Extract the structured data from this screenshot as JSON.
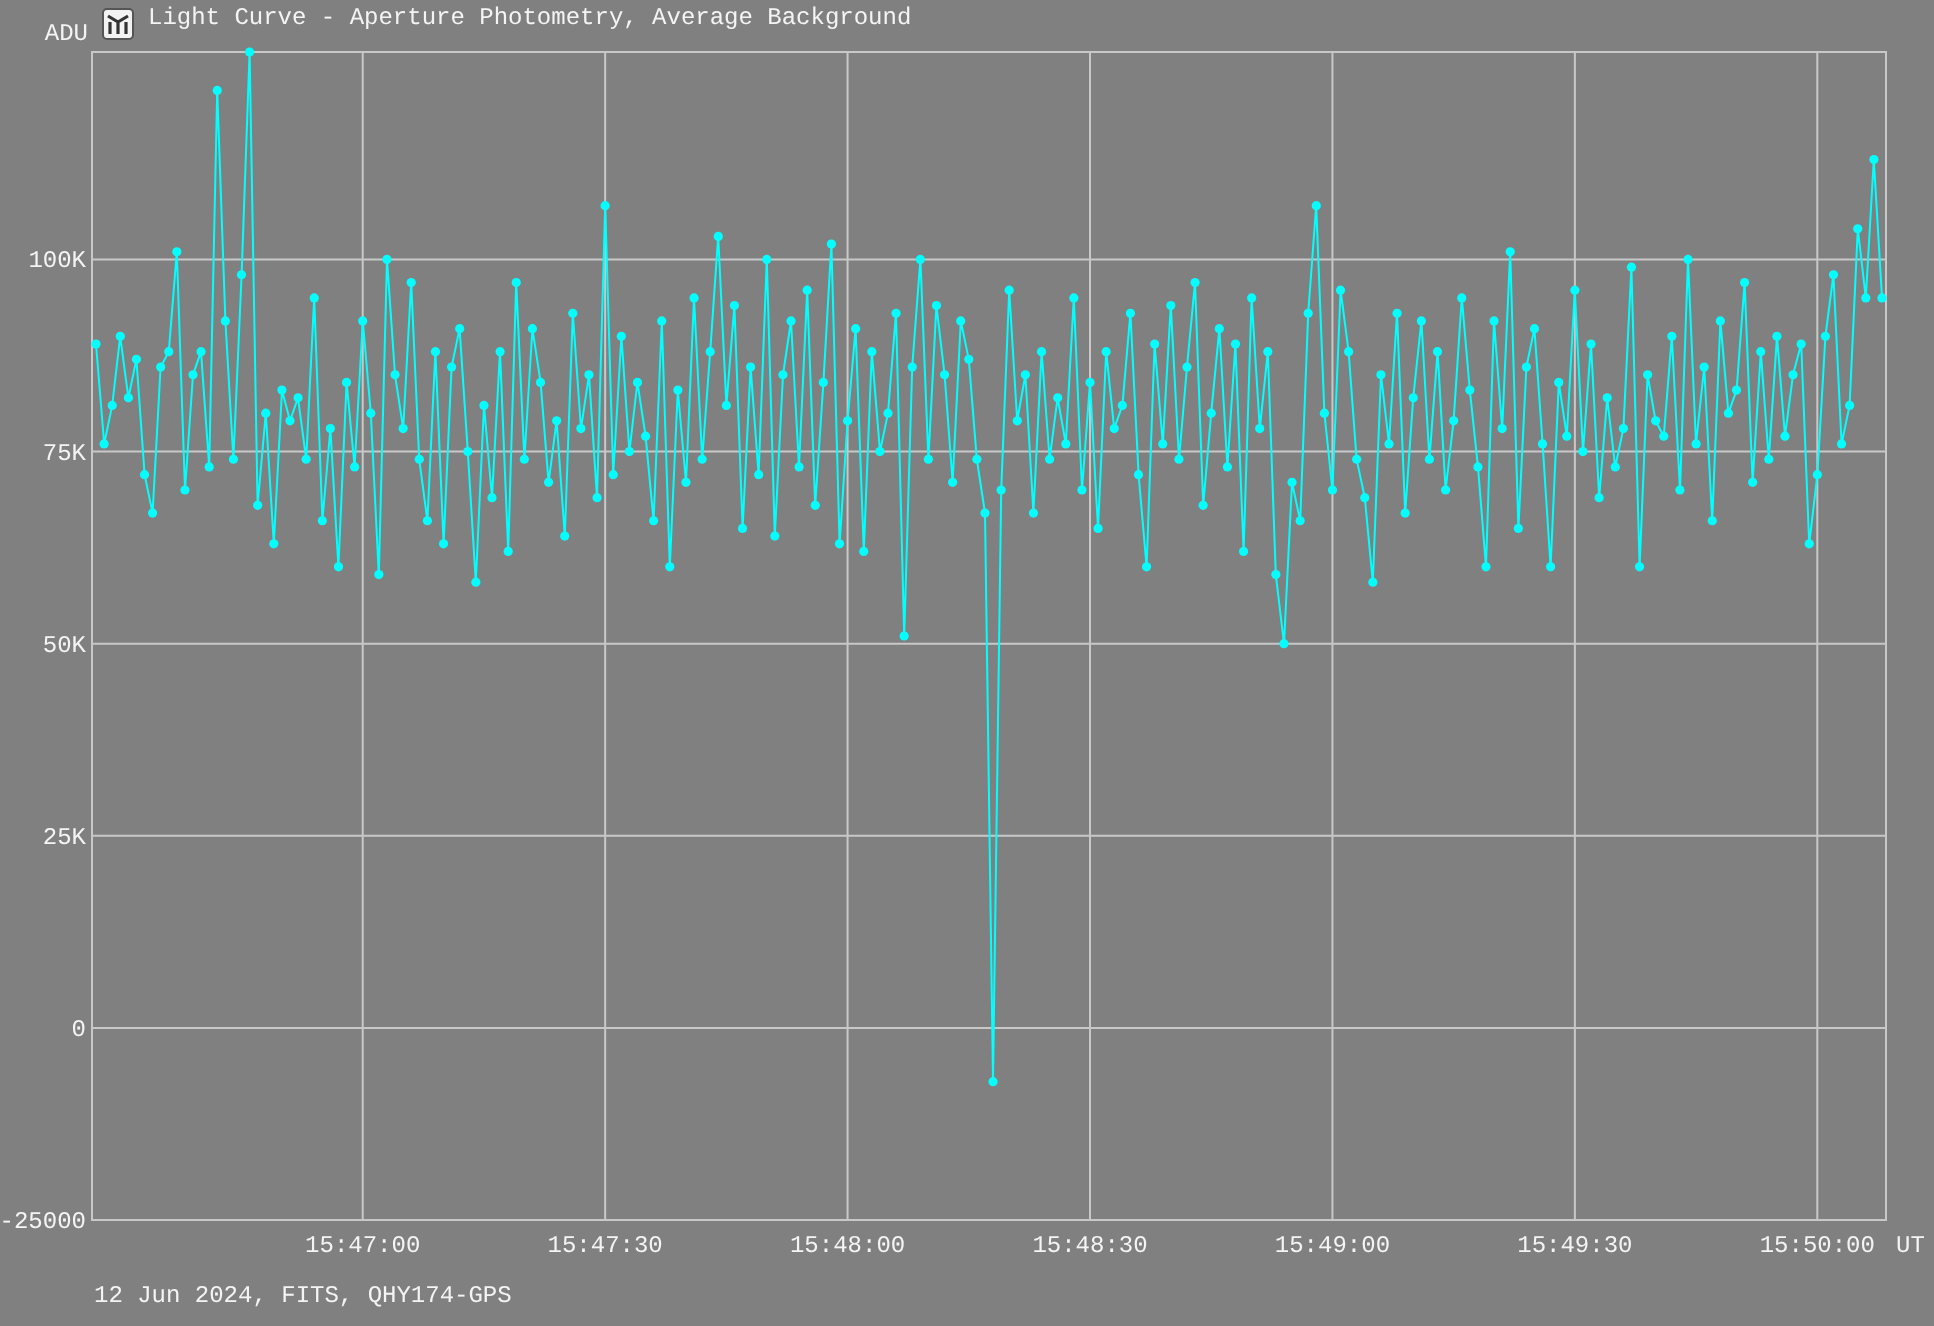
{
  "window": {
    "title": "Light Curve - Aperture Photometry, Average Background"
  },
  "chart_data": {
    "type": "line",
    "ylabel": "ADU",
    "xlabel": "UT",
    "grid": true,
    "categories": [
      null,
      null,
      null,
      null,
      null,
      null,
      null,
      null,
      null,
      null,
      null,
      null,
      null,
      null,
      null,
      null,
      null,
      null,
      null,
      null,
      null,
      null,
      null,
      null,
      null,
      null,
      null,
      null,
      null,
      null,
      null,
      null,
      null,
      "15:47:00",
      null,
      null,
      null,
      null,
      null,
      null,
      null,
      null,
      null,
      null,
      null,
      null,
      null,
      null,
      null,
      null,
      null,
      null,
      null,
      null,
      null,
      null,
      null,
      null,
      null,
      null,
      null,
      null,
      null,
      "15:47:30",
      null,
      null,
      null,
      null,
      null,
      null,
      null,
      null,
      null,
      null,
      null,
      null,
      null,
      null,
      null,
      null,
      null,
      null,
      null,
      null,
      null,
      null,
      null,
      null,
      null,
      null,
      null,
      null,
      null,
      "15:48:00",
      null,
      null,
      null,
      null,
      null,
      null,
      null,
      null,
      null,
      null,
      null,
      null,
      null,
      null,
      null,
      null,
      null,
      null,
      null,
      null,
      null,
      null,
      null,
      null,
      null,
      null,
      null,
      null,
      null,
      "15:48:30",
      null,
      null,
      null,
      null,
      null,
      null,
      null,
      null,
      null,
      null,
      null,
      null,
      null,
      null,
      null,
      null,
      null,
      null,
      null,
      null,
      null,
      null,
      null,
      null,
      null,
      null,
      null,
      null,
      null,
      "15:49:00",
      null,
      null,
      null,
      null,
      null,
      null,
      null,
      null,
      null,
      null,
      null,
      null,
      null,
      null,
      null,
      null,
      null,
      null,
      null,
      null,
      null,
      null,
      null,
      null,
      null,
      null,
      null,
      null,
      null,
      "15:49:30",
      null,
      null,
      null,
      null,
      null,
      null,
      null,
      null,
      null,
      null,
      null,
      null,
      null,
      null,
      null,
      null,
      null,
      null,
      null,
      null,
      null,
      null,
      null,
      null,
      null,
      null,
      null,
      null,
      null,
      "15:50:00",
      null,
      null,
      null,
      null,
      null,
      null,
      null,
      null
    ],
    "ylim": [
      -25000,
      127000
    ],
    "yticks": [
      {
        "value": -25000,
        "label": "-25000"
      },
      {
        "value": 0,
        "label": "0"
      },
      {
        "value": 25000,
        "label": "25K"
      },
      {
        "value": 50000,
        "label": "50K"
      },
      {
        "value": 75000,
        "label": "75K"
      },
      {
        "value": 100000,
        "label": "100K"
      }
    ],
    "series": [
      {
        "color": "#00ffff",
        "marker": "circle",
        "values": [
          89000,
          76000,
          81000,
          90000,
          82000,
          87000,
          72000,
          67000,
          86000,
          88000,
          101000,
          70000,
          85000,
          88000,
          73000,
          122000,
          92000,
          74000,
          98000,
          127000,
          68000,
          80000,
          63000,
          83000,
          79000,
          82000,
          74000,
          95000,
          66000,
          78000,
          60000,
          84000,
          73000,
          92000,
          80000,
          59000,
          100000,
          85000,
          78000,
          97000,
          74000,
          66000,
          88000,
          63000,
          86000,
          91000,
          75000,
          58000,
          81000,
          69000,
          88000,
          62000,
          97000,
          74000,
          91000,
          84000,
          71000,
          79000,
          64000,
          93000,
          78000,
          85000,
          69000,
          107000,
          72000,
          90000,
          75000,
          84000,
          77000,
          66000,
          92000,
          60000,
          83000,
          71000,
          95000,
          74000,
          88000,
          103000,
          81000,
          94000,
          65000,
          86000,
          72000,
          100000,
          64000,
          85000,
          92000,
          73000,
          96000,
          68000,
          84000,
          102000,
          63000,
          79000,
          91000,
          62000,
          88000,
          75000,
          80000,
          93000,
          51000,
          86000,
          100000,
          74000,
          94000,
          85000,
          71000,
          92000,
          87000,
          74000,
          67000,
          -7000,
          70000,
          96000,
          79000,
          85000,
          67000,
          88000,
          74000,
          82000,
          76000,
          95000,
          70000,
          84000,
          65000,
          88000,
          78000,
          81000,
          93000,
          72000,
          60000,
          89000,
          76000,
          94000,
          74000,
          86000,
          97000,
          68000,
          80000,
          91000,
          73000,
          89000,
          62000,
          95000,
          78000,
          88000,
          59000,
          50000,
          71000,
          66000,
          93000,
          107000,
          80000,
          70000,
          96000,
          88000,
          74000,
          69000,
          58000,
          85000,
          76000,
          93000,
          67000,
          82000,
          92000,
          74000,
          88000,
          70000,
          79000,
          95000,
          83000,
          73000,
          60000,
          92000,
          78000,
          101000,
          65000,
          86000,
          91000,
          76000,
          60000,
          84000,
          77000,
          96000,
          75000,
          89000,
          69000,
          82000,
          73000,
          78000,
          99000,
          60000,
          85000,
          79000,
          77000,
          90000,
          70000,
          100000,
          76000,
          86000,
          66000,
          92000,
          80000,
          83000,
          97000,
          71000,
          88000,
          74000,
          90000,
          77000,
          85000,
          89000,
          63000,
          72000,
          90000,
          98000,
          76000,
          81000,
          104000,
          95000,
          113000,
          95000
        ]
      }
    ]
  },
  "footer": "12 Jun 2024, FITS, QHY174-GPS"
}
